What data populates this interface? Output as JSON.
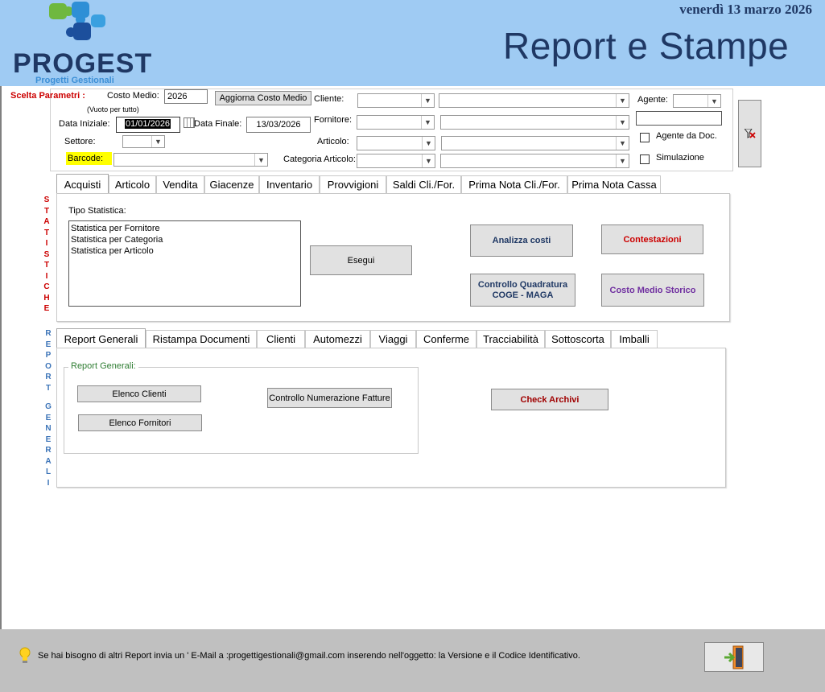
{
  "header": {
    "date": "venerdì 13 marzo 2026",
    "title": "Report e Stampe",
    "logo_text": "PROGEST",
    "logo_subtitle": "Progetti Gestionali"
  },
  "params": {
    "section_label": "Scelta Parametri :",
    "costo_medio_label": "Costo Medio:",
    "costo_medio_value": "2026",
    "aggiorna_button": "Aggiorna Costo Medio",
    "vuoto_hint": "(Vuoto per tutto)",
    "data_iniziale_label": "Data Iniziale:",
    "data_iniziale_value": "01/01/2026",
    "data_finale_label": "Data Finale:",
    "data_finale_value": "13/03/2026",
    "settore_label": "Settore:",
    "barcode_label": "Barcode:",
    "cliente_label": "Cliente:",
    "fornitore_label": "Fornitore:",
    "articolo_label": "Articolo:",
    "categoria_label": "Categoria Articolo:",
    "agente_label": "Agente:",
    "agente_da_doc_label": "Agente da Doc.",
    "simulazione_label": "Simulazione"
  },
  "statistiche": {
    "side_label": "STATISTICHE",
    "tabs": [
      "Acquisti",
      "Articolo",
      "Vendita",
      "Giacenze",
      "Inventario",
      "Provvigioni",
      "Saldi Cli./For.",
      "Prima Nota Cli./For.",
      "Prima Nota Cassa"
    ],
    "tipo_label": "Tipo Statistica:",
    "tipo_items": [
      "Statistica per Fornitore",
      "Statistica per Categoria",
      "Statistica per Articolo"
    ],
    "esegui": "Esegui",
    "analizza_costi": "Analizza costi",
    "contestazioni": "Contestazioni",
    "controllo_quadratura_line1": "Controllo Quadratura",
    "controllo_quadratura_line2": "COGE - MAGA",
    "costo_medio_storico": "Costo Medio Storico"
  },
  "report": {
    "side_label_1": "REPORT",
    "side_label_2": "GENERALI",
    "tabs": [
      "Report Generali",
      "Ristampa Documenti",
      "Clienti",
      "Automezzi",
      "Viaggi",
      "Conferme",
      "Tracciabilità",
      "Sottoscorta",
      "Imballi"
    ],
    "group_label": "Report Generali:",
    "elenco_clienti": "Elenco Clienti",
    "elenco_fornitori": "Elenco Fornitori",
    "controllo_numerazione": "Controllo Numerazione Fatture",
    "check_archivi": "Check Archivi"
  },
  "footer": {
    "message": "Se hai bisogno di altri Report invia un ' E-Mail a :progettigestionali@gmail.com  inserendo nell'oggetto: la Versione e il Codice Identificativo."
  },
  "icons": {
    "logo": "puzzle-logo-icon",
    "clear_filter": "clear-filter-icon",
    "calendar": "calendar-icon",
    "lightbulb": "lightbulb-icon",
    "exit": "exit-door-icon"
  },
  "colors": {
    "header_bg": "#9fcbf3",
    "title": "#1f3864",
    "red_label": "#cc0000",
    "barcode_highlight": "#ffff00",
    "blue_button_text": "#1f3864",
    "purple_button_text": "#7030a0",
    "footer_bg": "#c0c0c0"
  }
}
